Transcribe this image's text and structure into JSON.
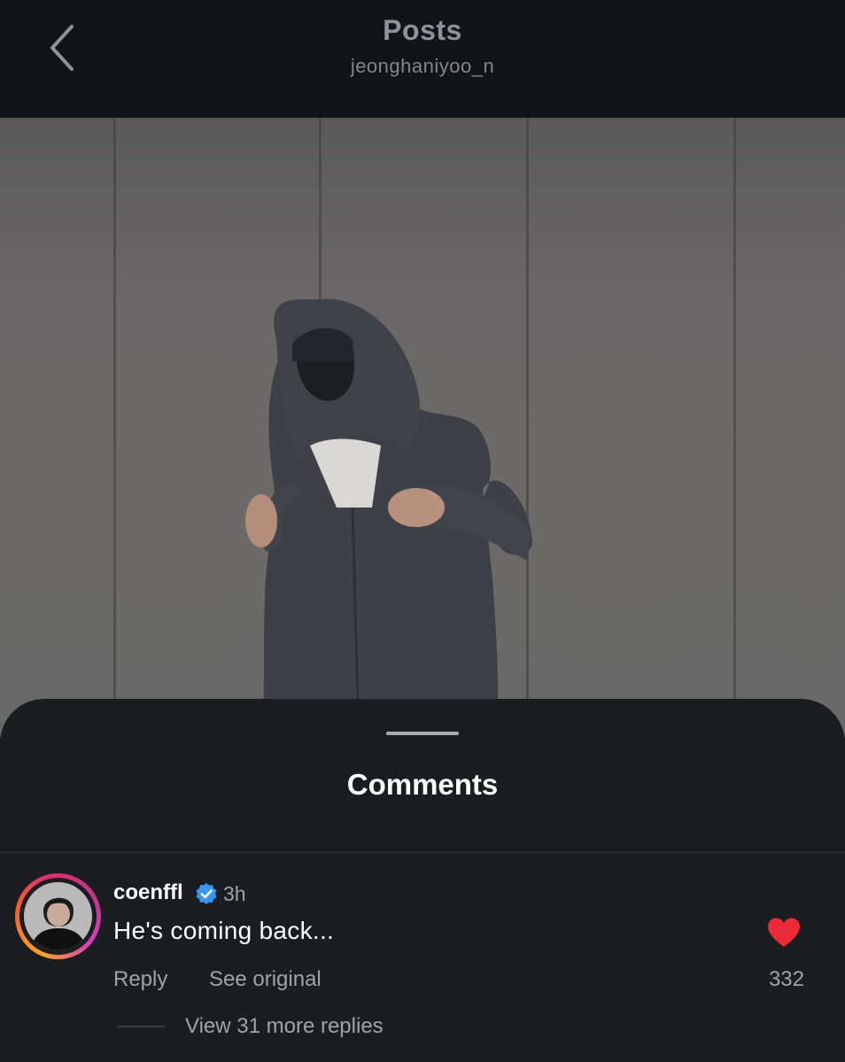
{
  "header": {
    "title": "Posts",
    "username": "jeonghaniyoo_n",
    "back_icon": "chevron-left-icon"
  },
  "video": {
    "description_icon": "video-frame"
  },
  "comments_sheet": {
    "title": "Comments",
    "comments": [
      {
        "username": "coenffl",
        "verified": true,
        "time": "3h",
        "text": "He's coming back...",
        "reply_label": "Reply",
        "see_original_label": "See original",
        "liked": true,
        "like_count": "332",
        "view_replies_label": "View 31 more replies"
      }
    ]
  },
  "colors": {
    "background": "#121418",
    "sheet": "#1b1d21",
    "like_red": "#ed2b38",
    "verified_blue": "#3797f0",
    "muted_text": "#a0a3a8"
  }
}
